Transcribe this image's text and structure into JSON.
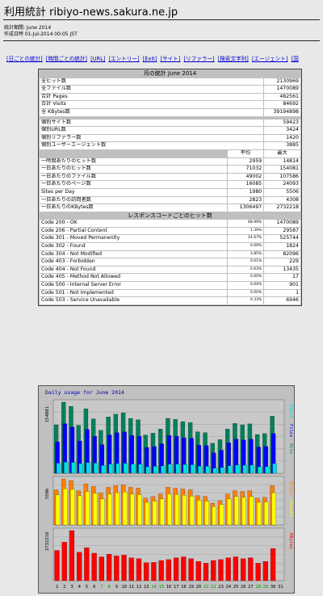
{
  "header": {
    "title": "利用統計 ribiyo-news.sakura.ne.jp",
    "period": "統計期間: June 2014",
    "generated": "作成日時 01-Jul-2014 00:05 JST"
  },
  "nav": [
    "[日ごとの統計]",
    "[時間ごとの統計]",
    "[URL]",
    "[エントリー]",
    "[Exit]",
    "[サイト]",
    "[リファラー]",
    "[検索文字列]",
    "[エージェント]",
    "[国"
  ],
  "stats": {
    "title": "月の統計 June 2014",
    "totals": [
      {
        "label": "全ヒット数",
        "value": "2130969"
      },
      {
        "label": "全ファイル数",
        "value": "1470089"
      },
      {
        "label": "合計 Pages",
        "value": "482561"
      },
      {
        "label": "合計 Visits",
        "value": "84692"
      },
      {
        "label": "全 KBytes数",
        "value": "39194898"
      }
    ],
    "uniques": [
      {
        "label": "個別サイト数",
        "value": "59423"
      },
      {
        "label": "個別URL数",
        "value": "3424"
      },
      {
        "label": "個別リファラー数",
        "value": "1420"
      },
      {
        "label": "個別ユーザーエージェント数",
        "value": "3885"
      }
    ],
    "avg_max_header": {
      "avg": "平均",
      "max": "最大"
    },
    "averages": [
      {
        "label": "一時間あたりのヒット数",
        "avg": "2959",
        "max": "14814"
      },
      {
        "label": "一日あたりのヒット数",
        "avg": "71032",
        "max": "154081"
      },
      {
        "label": "一日あたりのファイル数",
        "avg": "49002",
        "max": "107586"
      },
      {
        "label": "一日あたりのページ数",
        "avg": "16085",
        "max": "24093"
      },
      {
        "label": "Sites per Day",
        "avg": "1980",
        "max": "5506"
      },
      {
        "label": "一日あたりの訪問者数",
        "avg": "2823",
        "max": "4308"
      },
      {
        "label": "一日あたりのKBytes数",
        "avg": "1306497",
        "max": "2732218"
      }
    ],
    "codes_title": "レスポンスコードごとのヒット数",
    "codes": [
      {
        "label": "Code 200 - OK",
        "pct": "68.99%",
        "value": "1470089"
      },
      {
        "label": "Code 206 - Partial Content",
        "pct": "1.39%",
        "value": "29587"
      },
      {
        "label": "Code 301 - Moved Permanently",
        "pct": "24.67%",
        "value": "525744"
      },
      {
        "label": "Code 302 - Found",
        "pct": "0.09%",
        "value": "1824"
      },
      {
        "label": "Code 304 - Not Modified",
        "pct": "3.85%",
        "value": "82096"
      },
      {
        "label": "Code 403 - Forbidden",
        "pct": "0.01%",
        "value": "229"
      },
      {
        "label": "Code 404 - Not Found",
        "pct": "0.63%",
        "value": "13435"
      },
      {
        "label": "Code 405 - Method Not Allowed",
        "pct": "0.00%",
        "value": "17"
      },
      {
        "label": "Code 500 - Internal Server Error",
        "pct": "0.04%",
        "value": "901"
      },
      {
        "label": "Code 501 - Not Implemented",
        "pct": "0.00%",
        "value": "1"
      },
      {
        "label": "Code 503 - Service Unavailable",
        "pct": "0.33%",
        "value": "6946"
      }
    ]
  },
  "chart_data": {
    "type": "bar",
    "title": "Daily usage for June 2014",
    "x": [
      1,
      2,
      3,
      4,
      5,
      6,
      7,
      8,
      9,
      10,
      11,
      12,
      13,
      14,
      15,
      16,
      17,
      18,
      19,
      20,
      21,
      22,
      23,
      24,
      25,
      26,
      27,
      28,
      29,
      30,
      31
    ],
    "ylabels": {
      "top": "154081",
      "mid": "5506",
      "bottom": "2732218"
    },
    "legend_top": [
      "Pages",
      "Files",
      "Hits"
    ],
    "legend_mid": [
      "Sites",
      "Visits"
    ],
    "legend_bottom": [
      "KBytes"
    ],
    "hits": [
      105000,
      154081,
      145000,
      104000,
      140000,
      118000,
      93000,
      122000,
      128000,
      131000,
      119000,
      116000,
      83000,
      87000,
      96000,
      119000,
      117000,
      112000,
      110000,
      90000,
      88000,
      65000,
      73000,
      96000,
      108000,
      105000,
      107000,
      84000,
      86000,
      124000,
      0
    ],
    "files": [
      68000,
      107586,
      100000,
      70000,
      95000,
      80000,
      62000,
      83000,
      88000,
      90000,
      82000,
      80000,
      56000,
      58000,
      64000,
      82000,
      80000,
      77000,
      76000,
      61000,
      60000,
      44000,
      50000,
      66000,
      74000,
      72000,
      74000,
      57000,
      58000,
      86000,
      0
    ],
    "pages": [
      22000,
      24093,
      23500,
      21000,
      23000,
      22000,
      17000,
      20000,
      21000,
      21500,
      20000,
      19500,
      14000,
      15000,
      16000,
      20000,
      19800,
      19000,
      18500,
      15500,
      15000,
      11000,
      12500,
      16500,
      18000,
      17500,
      18000,
      14000,
      14500,
      21000,
      0
    ],
    "sites": [
      4200,
      5506,
      5300,
      4100,
      4900,
      4600,
      3800,
      4500,
      4700,
      4800,
      4500,
      4400,
      3200,
      3400,
      3700,
      4500,
      4400,
      4300,
      4200,
      3500,
      3400,
      2600,
      2900,
      3700,
      4100,
      4000,
      4100,
      3200,
      3300,
      4700,
      0
    ],
    "visits": [
      3600,
      4308,
      4250,
      3500,
      4000,
      3800,
      3100,
      3700,
      3850,
      3950,
      3700,
      3600,
      2700,
      2850,
      3100,
      3700,
      3650,
      3550,
      3450,
      2950,
      2850,
      2200,
      2450,
      3100,
      3400,
      3300,
      3400,
      2700,
      2750,
      3850,
      0
    ],
    "kbytes": [
      1650000,
      2100000,
      2732218,
      1550000,
      1800000,
      1500000,
      1300000,
      1450000,
      1350000,
      1400000,
      1250000,
      1200000,
      980000,
      1000000,
      1100000,
      1150000,
      1250000,
      1300000,
      1200000,
      1050000,
      950000,
      1100000,
      1150000,
      1250000,
      1300000,
      1200000,
      1250000,
      950000,
      1050000,
      1750000,
      0
    ],
    "colors": {
      "hits": "#00805c",
      "files": "#0000ff",
      "pages": "#00e0e0",
      "sites": "#ff8000",
      "visits": "#ffff00",
      "kbytes": "#ff0000",
      "bg": "#c0c0c0",
      "weekend": "#00a000"
    }
  }
}
